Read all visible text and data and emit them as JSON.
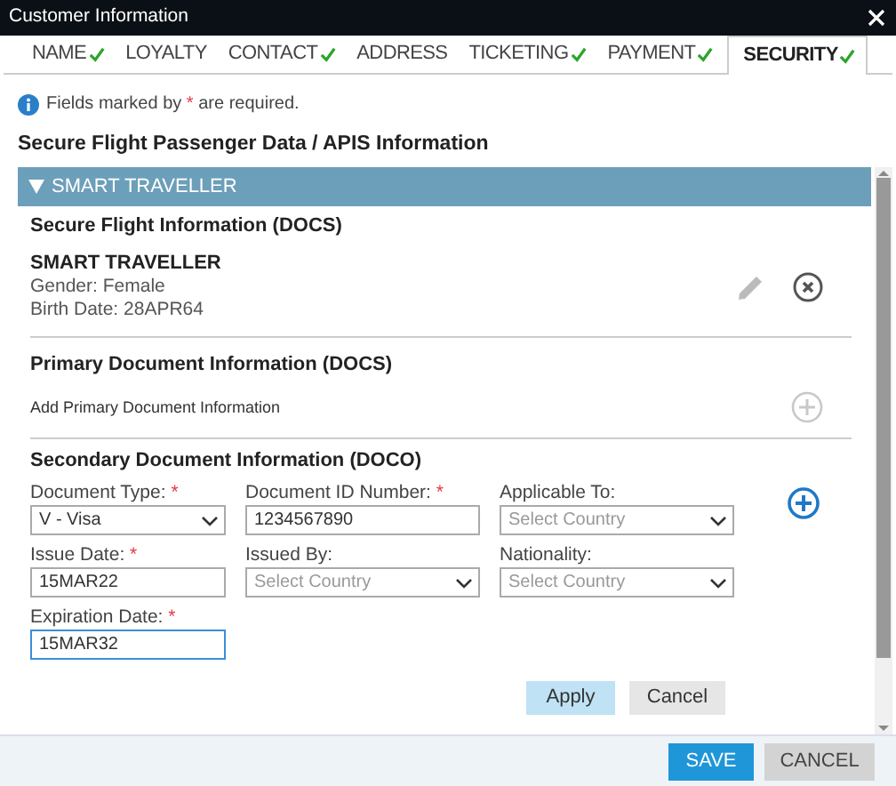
{
  "window": {
    "title": "Customer Information"
  },
  "tabs": [
    {
      "label": "NAME",
      "complete": true,
      "selected": false
    },
    {
      "label": "LOYALTY",
      "complete": false,
      "selected": false
    },
    {
      "label": "CONTACT",
      "complete": true,
      "selected": false
    },
    {
      "label": "ADDRESS",
      "complete": false,
      "selected": false
    },
    {
      "label": "TICKETING",
      "complete": true,
      "selected": false
    },
    {
      "label": "PAYMENT",
      "complete": true,
      "selected": false
    },
    {
      "label": "SECURITY",
      "complete": true,
      "selected": true
    }
  ],
  "note": {
    "text_before": "Fields marked by",
    "required_mark": "*",
    "text_after": "are required."
  },
  "heading": "Secure Flight Passenger Data / APIS Information",
  "panel": {
    "title": "SMART TRAVELLER",
    "expanded": true,
    "secure_flight": {
      "title": "Secure Flight Information (DOCS)",
      "name": "SMART TRAVELLER",
      "gender": "Gender: Female",
      "birth_date": "Birth Date: 28APR64"
    },
    "primary": {
      "title": "Primary Document Information (DOCS)",
      "add_label": "Add Primary Document Information",
      "add_disabled": true
    },
    "secondary": {
      "title": "Secondary Document Information (DOCO)",
      "add_disabled": false,
      "fields": [
        {
          "label": "Document Type:",
          "mark": "*",
          "kind": "select",
          "value": "V - Visa",
          "focused": false
        },
        {
          "label": "Document ID Number:",
          "mark": "*",
          "kind": "text",
          "value": "1234567890",
          "focused": false
        },
        {
          "label": "Applicable To:",
          "kind": "select",
          "placeholder": "Select Country",
          "focused": false
        },
        {
          "label": "Issue Date:",
          "mark": "*",
          "kind": "text",
          "value": "15MAR22",
          "focused": false
        },
        {
          "label": "Issued By:",
          "kind": "select",
          "placeholder": "Select Country",
          "focused": false
        },
        {
          "label": "Nationality:",
          "kind": "select",
          "placeholder": "Select Country",
          "focused": false
        },
        {
          "label": "Expiration Date:",
          "mark": "*",
          "kind": "text",
          "value": "15MAR32",
          "focused": true
        }
      ],
      "buttons": [
        {
          "label": "Apply",
          "kind": "primary"
        },
        {
          "label": "Cancel",
          "kind": "secondary"
        }
      ]
    }
  },
  "footer_buttons": [
    {
      "label": "SAVE",
      "kind": "primary"
    },
    {
      "label": "CANCEL",
      "kind": "secondary"
    }
  ]
}
